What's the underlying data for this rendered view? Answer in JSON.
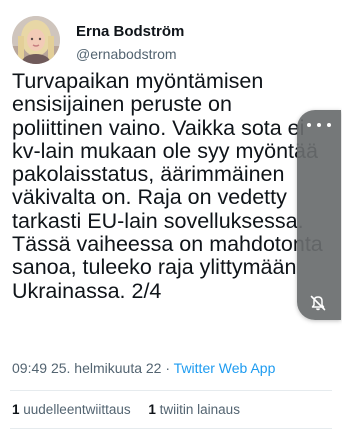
{
  "author": {
    "display_name": "Erna Bodström",
    "handle": "@ernabodstrom"
  },
  "tweet": {
    "text_lines": [
      "Turvapaikan myöntämisen",
      "ensisijainen peruste on",
      "poliittinen vaino. Vaikka sota ei",
      "kv-lain mukaan ole syy myöntää",
      "pakolaisstatus, äärimmäinen",
      "väkivalta on. Raja on vedetty",
      "tarkasti EU-lain sovelluksessa.",
      "Tässä vaiheessa on mahdotonta",
      "sanoa, tuleeko raja ylittymään",
      "Ukrainassa. 2/4"
    ]
  },
  "meta": {
    "time": "09:49",
    "date": "25. helmikuuta 22",
    "separator": "·",
    "source": "Twitter Web App"
  },
  "stats": {
    "retweets_count": "1",
    "retweets_label": "uudelleentwiittaus",
    "quotes_count": "1",
    "quotes_label": "twiitin lainaus"
  },
  "overlay": {
    "more_icon": "more-dots-icon",
    "mute_icon": "mute-icon"
  },
  "colors": {
    "link": "#1d9bf0",
    "secondary_text": "#536471",
    "primary_text": "#0f1419"
  }
}
